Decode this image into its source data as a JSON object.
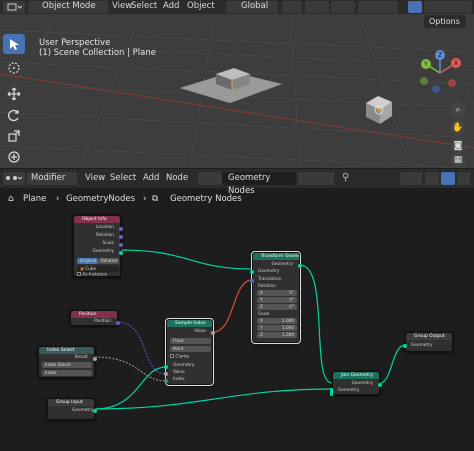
{
  "viewport": {
    "header": {
      "mode": "Object Mode",
      "menus": [
        "View",
        "Select",
        "Add",
        "Object"
      ],
      "orientation": "Global"
    },
    "overlay": {
      "perspective": "User Perspective",
      "collection": "(1) Scene Collection | Plane"
    },
    "options_label": "Options",
    "gizmo": {
      "x": "X",
      "y": "Y",
      "z": "Z"
    }
  },
  "node_editor": {
    "header": {
      "editor_type": "Modifier",
      "menus": [
        "View",
        "Select",
        "Add",
        "Node"
      ],
      "node_tree": "Geometry Nodes"
    },
    "breadcrumb": [
      "Plane",
      "GeometryNodes",
      "Geometry Nodes"
    ],
    "nodes": {
      "object_info": {
        "title": "Object Info",
        "outputs": [
          "Location",
          "Rotation",
          "Scale",
          "Geometry"
        ],
        "toggle": [
          "Original",
          "Relative"
        ],
        "object_field": "Cube",
        "as_instance": "As Instance"
      },
      "position": {
        "title": "Position",
        "output": "Position"
      },
      "index_select": {
        "title": "Index Select",
        "output": "Result",
        "field": "Index Select",
        "input": "Index"
      },
      "group_input": {
        "title": "Group Input",
        "output": "Geometry"
      },
      "sample_index": {
        "title": "Sample Index",
        "output": "Value",
        "type": "Float",
        "domain": "Point",
        "inputs": [
          "Geometry",
          "Value",
          "Index"
        ],
        "clamp": "Clamp"
      },
      "transform": {
        "title": "Transform Geometry",
        "output": "Geometry",
        "input": "Geometry",
        "translation": "Translation",
        "rotation_label": "Rotation",
        "rotation": [
          {
            "axis": "X",
            "value": "0°"
          },
          {
            "axis": "Y",
            "value": "0°"
          },
          {
            "axis": "Z",
            "value": "0°"
          }
        ],
        "scale_label": "Scale",
        "scale": [
          {
            "axis": "X",
            "value": "1.000"
          },
          {
            "axis": "Y",
            "value": "1.000"
          },
          {
            "axis": "Z",
            "value": "1.000"
          }
        ]
      },
      "join": {
        "title": "Join Geometry",
        "output": "Geometry",
        "input": "Geometry"
      },
      "group_output": {
        "title": "Group Output",
        "input": "Geometry"
      }
    }
  },
  "colors": {
    "geometry_socket": "#00d6a3",
    "vector_socket": "#6363c7",
    "float_socket": "#a1a1a1",
    "int_socket": "#598c5c",
    "geometry_header": "#1d725e",
    "input_header": "#83314a",
    "converter_header": "#3b5959",
    "accent": "#4772b3"
  }
}
